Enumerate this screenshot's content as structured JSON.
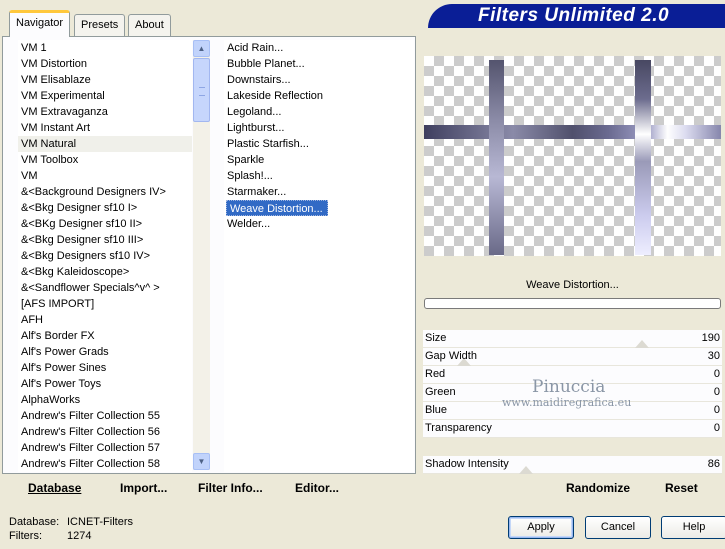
{
  "tabs": [
    {
      "label": "Navigator",
      "active": true
    },
    {
      "label": "Presets",
      "active": false
    },
    {
      "label": "About",
      "active": false
    }
  ],
  "banner_title": "Filters Unlimited 2.0",
  "categories": [
    "VM 1",
    "VM Distortion",
    "VM Elisablaze",
    "VM Experimental",
    "VM Extravaganza",
    "VM Instant Art",
    "VM Natural",
    "VM Toolbox",
    "VM",
    "&<Background Designers IV>",
    "&<Bkg Designer sf10 I>",
    "&<BKg Designer sf10 II>",
    "&<Bkg Designer sf10 III>",
    "&<Bkg Designers sf10 IV>",
    "&<Bkg Kaleidoscope>",
    "&<Sandflower Specials^v^ >",
    "[AFS IMPORT]",
    "AFH",
    "Alf's Border FX",
    "Alf's Power Grads",
    "Alf's Power Sines",
    "Alf's Power Toys",
    "AlphaWorks",
    "Andrew's Filter Collection 55",
    "Andrew's Filter Collection 56",
    "Andrew's Filter Collection 57",
    "Andrew's Filter Collection 58"
  ],
  "selected_category": "VM Natural",
  "filters": [
    "Acid Rain...",
    "Bubble Planet...",
    "Downstairs...",
    "Lakeside Reflection",
    "Legoland...",
    "Lightburst...",
    "Plastic Starfish...",
    "Sparkle",
    "Splash!...",
    "Starmaker...",
    "Weave Distortion...",
    "Welder..."
  ],
  "selected_filter": "Weave Distortion...",
  "links": {
    "database": "Database",
    "import": "Import...",
    "filter_info": "Filter Info...",
    "editor": "Editor..."
  },
  "filter_name": "Weave Distortion...",
  "params": [
    {
      "label": "Size",
      "value": "190",
      "level": 0.745
    },
    {
      "label": "Gap Width",
      "value": "30",
      "level": 0.118
    },
    {
      "label": "Red",
      "value": "0",
      "level": 0
    },
    {
      "label": "Green",
      "value": "0",
      "level": 0
    },
    {
      "label": "Blue",
      "value": "0",
      "level": 0
    },
    {
      "label": "Transparency",
      "value": "0",
      "level": 0
    }
  ],
  "shadow": {
    "label": "Shadow Intensity",
    "value": "86",
    "level": 0.337
  },
  "randomize_label": "Randomize",
  "reset_label": "Reset",
  "watermark": {
    "line1": "Pinuccia",
    "line2": "www.maidiregrafica.eu"
  },
  "status": {
    "database_label": "Database:",
    "database_value": "ICNET-Filters",
    "filters_label": "Filters:",
    "filters_value": "1274"
  },
  "buttons": {
    "apply": "Apply",
    "cancel": "Cancel",
    "help": "Help"
  }
}
